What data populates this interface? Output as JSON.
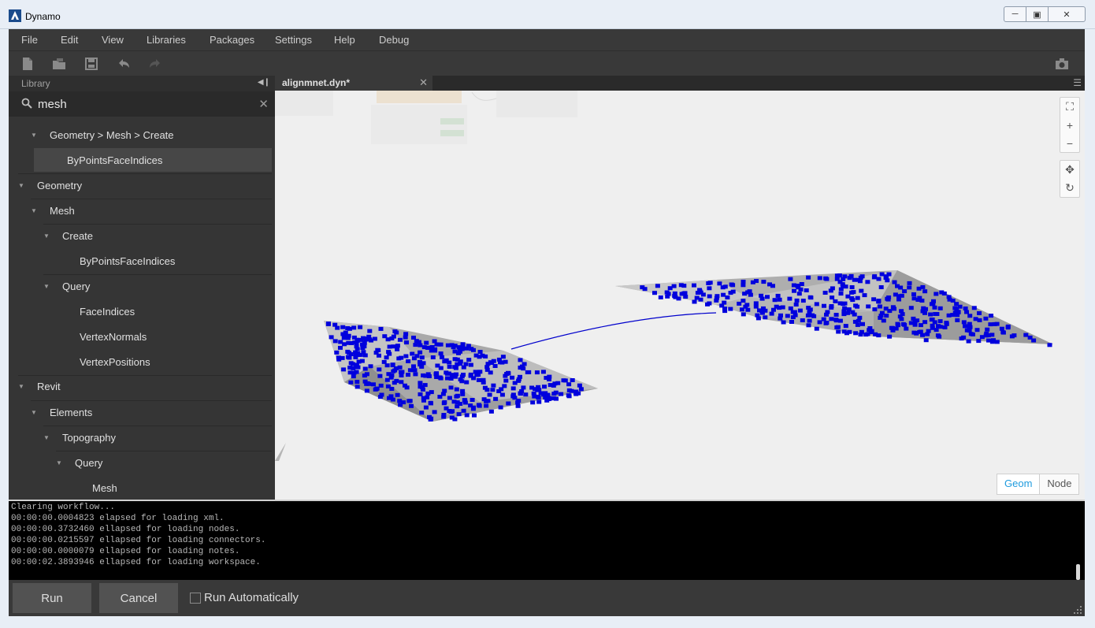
{
  "window": {
    "title": "Dynamo"
  },
  "menu": [
    "File",
    "Edit",
    "View",
    "Libraries",
    "Packages",
    "Settings",
    "Help",
    "Debug"
  ],
  "library": {
    "title": "Library",
    "search_value": "mesh",
    "items": [
      {
        "label": "Geometry > Mesh > Create",
        "level": 1,
        "expandable": true
      },
      {
        "label": "ByPointsFaceIndices",
        "level": 2,
        "expandable": false,
        "selected": true
      },
      {
        "label": "Geometry",
        "level": 0,
        "expandable": true
      },
      {
        "label": "Mesh",
        "level": 1,
        "expandable": true
      },
      {
        "label": "Create",
        "level": 2,
        "expandable": true
      },
      {
        "label": "ByPointsFaceIndices",
        "level": 3,
        "expandable": false
      },
      {
        "label": "Query",
        "level": 2,
        "expandable": true
      },
      {
        "label": "FaceIndices",
        "level": 3,
        "expandable": false
      },
      {
        "label": "VertexNormals",
        "level": 3,
        "expandable": false
      },
      {
        "label": "VertexPositions",
        "level": 3,
        "expandable": false
      },
      {
        "label": "Revit",
        "level": 0,
        "expandable": true
      },
      {
        "label": "Elements",
        "level": 1,
        "expandable": true
      },
      {
        "label": "Topography",
        "level": 2,
        "expandable": true
      },
      {
        "label": "Query",
        "level": 3,
        "expandable": true
      },
      {
        "label": "Mesh",
        "level": 4,
        "expandable": false
      }
    ]
  },
  "tab": {
    "label": "alignmnet.dyn*"
  },
  "view_toggle": {
    "geom": "Geom",
    "node": "Node",
    "active": "Geom"
  },
  "console": [
    "Clearing workflow...",
    "00:00:00.0004823 elapsed for loading xml.",
    "00:00:00.3732460 ellapsed for loading nodes.",
    "00:00:00.0215597 ellapsed for loading connectors.",
    "00:00:00.0000079 ellapsed for loading notes.",
    "00:00:02.3893946 ellapsed for loading workspace."
  ],
  "buttons": {
    "run": "Run",
    "cancel": "Cancel",
    "run_auto": "Run Automatically"
  },
  "colors": {
    "accent": "#1f9bde",
    "point": "#0000dd",
    "mesh": "#a8a8a8"
  }
}
